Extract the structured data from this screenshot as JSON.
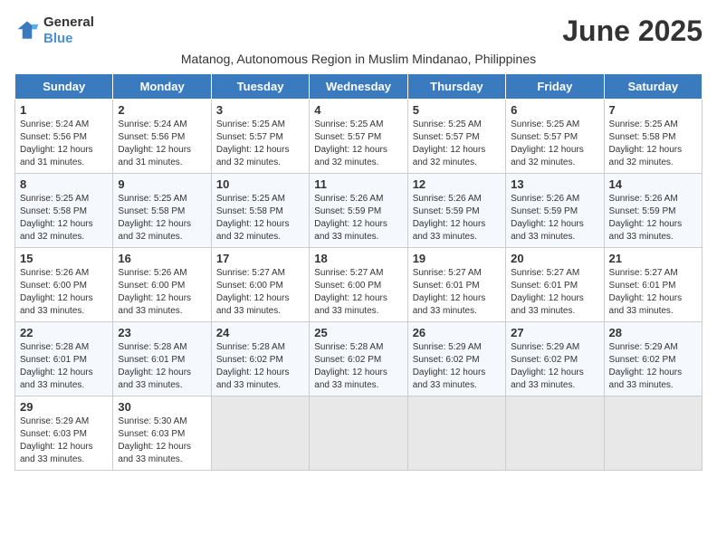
{
  "logo": {
    "general": "General",
    "blue": "Blue"
  },
  "title": "June 2025",
  "subtitle": "Matanog, Autonomous Region in Muslim Mindanao, Philippines",
  "weekdays": [
    "Sunday",
    "Monday",
    "Tuesday",
    "Wednesday",
    "Thursday",
    "Friday",
    "Saturday"
  ],
  "weeks": [
    [
      {
        "day": "1",
        "sunrise": "5:24 AM",
        "sunset": "5:56 PM",
        "daylight": "12 hours and 31 minutes."
      },
      {
        "day": "2",
        "sunrise": "5:24 AM",
        "sunset": "5:56 PM",
        "daylight": "12 hours and 31 minutes."
      },
      {
        "day": "3",
        "sunrise": "5:25 AM",
        "sunset": "5:57 PM",
        "daylight": "12 hours and 32 minutes."
      },
      {
        "day": "4",
        "sunrise": "5:25 AM",
        "sunset": "5:57 PM",
        "daylight": "12 hours and 32 minutes."
      },
      {
        "day": "5",
        "sunrise": "5:25 AM",
        "sunset": "5:57 PM",
        "daylight": "12 hours and 32 minutes."
      },
      {
        "day": "6",
        "sunrise": "5:25 AM",
        "sunset": "5:57 PM",
        "daylight": "12 hours and 32 minutes."
      },
      {
        "day": "7",
        "sunrise": "5:25 AM",
        "sunset": "5:58 PM",
        "daylight": "12 hours and 32 minutes."
      }
    ],
    [
      {
        "day": "8",
        "sunrise": "5:25 AM",
        "sunset": "5:58 PM",
        "daylight": "12 hours and 32 minutes."
      },
      {
        "day": "9",
        "sunrise": "5:25 AM",
        "sunset": "5:58 PM",
        "daylight": "12 hours and 32 minutes."
      },
      {
        "day": "10",
        "sunrise": "5:25 AM",
        "sunset": "5:58 PM",
        "daylight": "12 hours and 32 minutes."
      },
      {
        "day": "11",
        "sunrise": "5:26 AM",
        "sunset": "5:59 PM",
        "daylight": "12 hours and 33 minutes."
      },
      {
        "day": "12",
        "sunrise": "5:26 AM",
        "sunset": "5:59 PM",
        "daylight": "12 hours and 33 minutes."
      },
      {
        "day": "13",
        "sunrise": "5:26 AM",
        "sunset": "5:59 PM",
        "daylight": "12 hours and 33 minutes."
      },
      {
        "day": "14",
        "sunrise": "5:26 AM",
        "sunset": "5:59 PM",
        "daylight": "12 hours and 33 minutes."
      }
    ],
    [
      {
        "day": "15",
        "sunrise": "5:26 AM",
        "sunset": "6:00 PM",
        "daylight": "12 hours and 33 minutes."
      },
      {
        "day": "16",
        "sunrise": "5:26 AM",
        "sunset": "6:00 PM",
        "daylight": "12 hours and 33 minutes."
      },
      {
        "day": "17",
        "sunrise": "5:27 AM",
        "sunset": "6:00 PM",
        "daylight": "12 hours and 33 minutes."
      },
      {
        "day": "18",
        "sunrise": "5:27 AM",
        "sunset": "6:00 PM",
        "daylight": "12 hours and 33 minutes."
      },
      {
        "day": "19",
        "sunrise": "5:27 AM",
        "sunset": "6:01 PM",
        "daylight": "12 hours and 33 minutes."
      },
      {
        "day": "20",
        "sunrise": "5:27 AM",
        "sunset": "6:01 PM",
        "daylight": "12 hours and 33 minutes."
      },
      {
        "day": "21",
        "sunrise": "5:27 AM",
        "sunset": "6:01 PM",
        "daylight": "12 hours and 33 minutes."
      }
    ],
    [
      {
        "day": "22",
        "sunrise": "5:28 AM",
        "sunset": "6:01 PM",
        "daylight": "12 hours and 33 minutes."
      },
      {
        "day": "23",
        "sunrise": "5:28 AM",
        "sunset": "6:01 PM",
        "daylight": "12 hours and 33 minutes."
      },
      {
        "day": "24",
        "sunrise": "5:28 AM",
        "sunset": "6:02 PM",
        "daylight": "12 hours and 33 minutes."
      },
      {
        "day": "25",
        "sunrise": "5:28 AM",
        "sunset": "6:02 PM",
        "daylight": "12 hours and 33 minutes."
      },
      {
        "day": "26",
        "sunrise": "5:29 AM",
        "sunset": "6:02 PM",
        "daylight": "12 hours and 33 minutes."
      },
      {
        "day": "27",
        "sunrise": "5:29 AM",
        "sunset": "6:02 PM",
        "daylight": "12 hours and 33 minutes."
      },
      {
        "day": "28",
        "sunrise": "5:29 AM",
        "sunset": "6:02 PM",
        "daylight": "12 hours and 33 minutes."
      }
    ],
    [
      {
        "day": "29",
        "sunrise": "5:29 AM",
        "sunset": "6:03 PM",
        "daylight": "12 hours and 33 minutes."
      },
      {
        "day": "30",
        "sunrise": "5:30 AM",
        "sunset": "6:03 PM",
        "daylight": "12 hours and 33 minutes."
      },
      null,
      null,
      null,
      null,
      null
    ]
  ]
}
